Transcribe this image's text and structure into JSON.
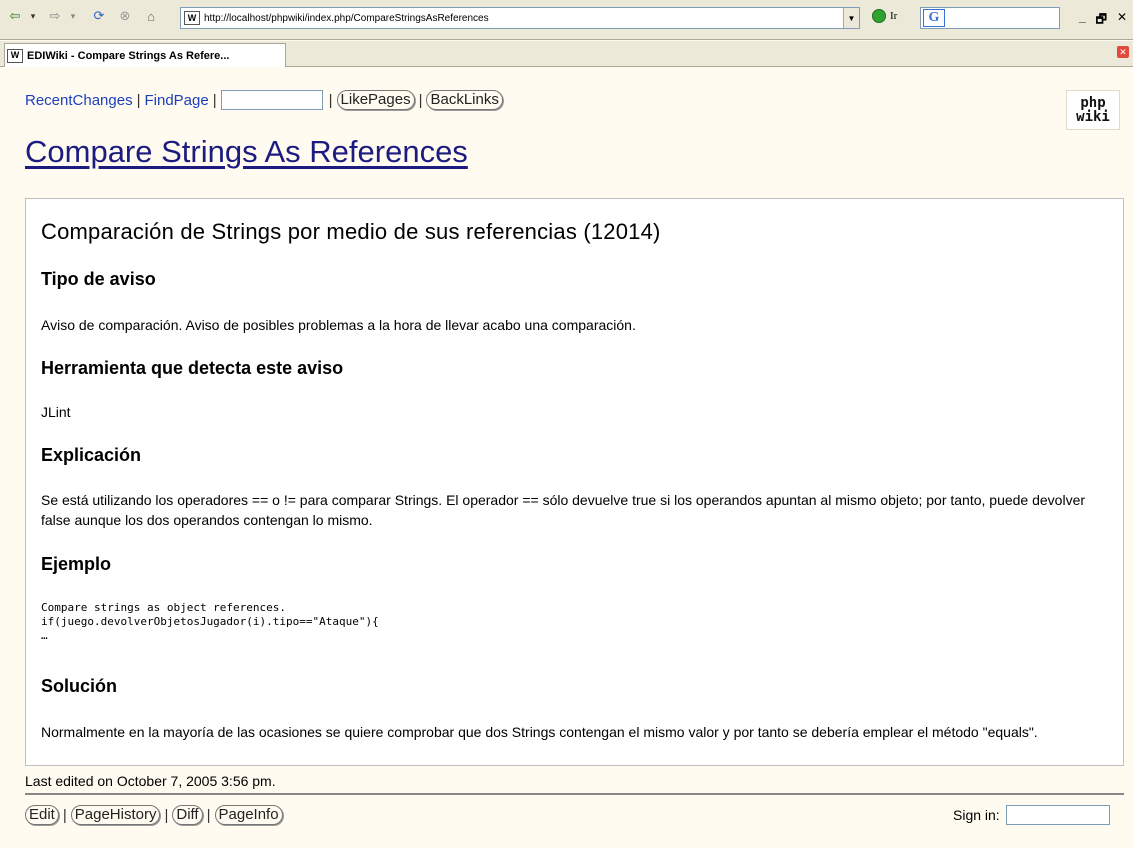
{
  "browser": {
    "url": "http://localhost/phpwiki/index.php/CompareStringsAsReferences",
    "go_label": "Ir",
    "tab_title": "EDIWiki - Compare Strings As Refere...",
    "search_logo": "G"
  },
  "nav": {
    "recent_changes": "RecentChanges",
    "find_page": "FindPage",
    "separator": "|",
    "like_pages": "LikePages",
    "back_links": "BackLinks"
  },
  "logo": {
    "line1": "php",
    "line2": "wiki"
  },
  "page": {
    "title": "Compare Strings As References",
    "heading": "Comparación de Strings por medio de sus referencias (12014)",
    "sections": [
      {
        "heading": "Tipo de aviso",
        "text": "Aviso de comparación. Aviso de posibles problemas a la hora de llevar acabo una comparación."
      },
      {
        "heading": "Herramienta que detecta este aviso",
        "text": "JLint"
      },
      {
        "heading": "Explicación",
        "text": "Se está utilizando los operadores == o != para comparar Strings. El operador == sólo devuelve true si los operandos apuntan al mismo objeto; por tanto, puede devolver false aunque los dos operandos contengan lo mismo."
      },
      {
        "heading": "Ejemplo",
        "code": "Compare strings as object references.\nif(juego.devolverObjetosJugador(i).tipo==\"Ataque\"){\n…"
      },
      {
        "heading": "Solución",
        "text": "Normalmente en la mayoría de las ocasiones se quiere comprobar que dos Strings contengan el mismo valor y por tanto se debería emplear el método \"equals\"."
      }
    ]
  },
  "footer": {
    "last_edited": "Last edited on October 7, 2005 3:56 pm.",
    "edit": "Edit",
    "page_history": "PageHistory",
    "diff": "Diff",
    "page_info": "PageInfo",
    "sign_in": "Sign in:"
  }
}
